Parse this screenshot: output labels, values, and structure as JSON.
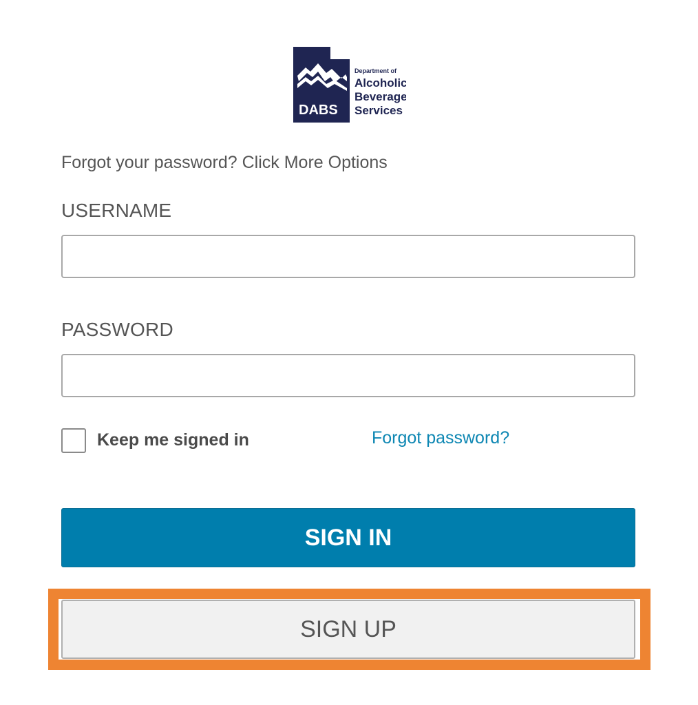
{
  "logo": {
    "abbrev": "DABS",
    "line1": "Department of",
    "line2": "Alcoholic",
    "line3": "Beverage",
    "line4": "Services",
    "color": "#1f2552"
  },
  "hint_text": "Forgot your password? Click More Options",
  "username": {
    "label": "USERNAME",
    "value": "",
    "placeholder": ""
  },
  "password": {
    "label": "PASSWORD",
    "value": "",
    "placeholder": ""
  },
  "keep_signed_in": {
    "label": "Keep me signed in",
    "checked": false
  },
  "forgot_password_link": "Forgot password?",
  "buttons": {
    "sign_in": "SIGN IN",
    "sign_up": "SIGN UP"
  },
  "colors": {
    "primary": "#007ead",
    "link": "#0e87b3",
    "highlight": "#ee8432",
    "secondary_button": "#f1f1f1"
  }
}
